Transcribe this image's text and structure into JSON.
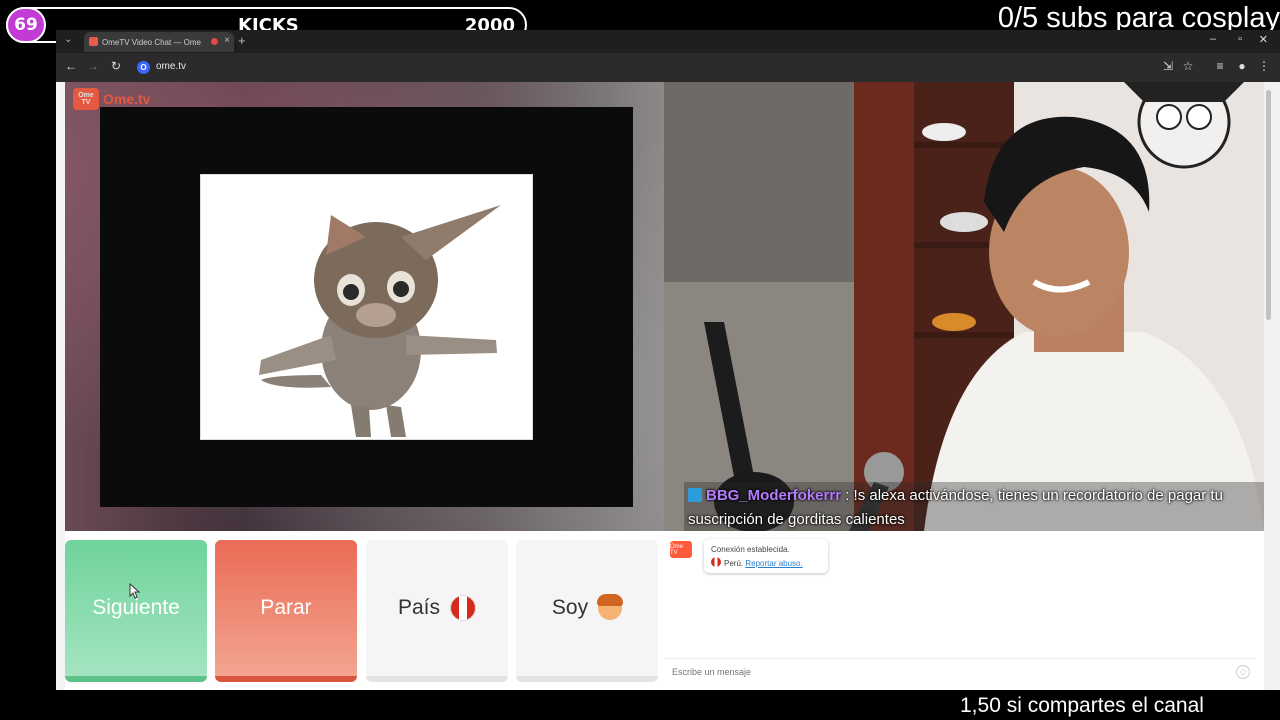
{
  "overlay": {
    "level_badge": "69",
    "kicks_label": "KICKS",
    "kicks_value": "2000",
    "subs_goal": "0/5 subs para cosplay",
    "share_text": "1,50 si compartes el canal"
  },
  "browser": {
    "tab_title": "OmeTV Video Chat — Ome",
    "url": "ome.tv",
    "new_tab": "+",
    "tab_close": "×"
  },
  "app": {
    "logo_text": "Ome.tv",
    "logo_badge": "Ome TV"
  },
  "controls": {
    "next_label": "Siguiente",
    "stop_label": "Parar",
    "country_label": "País",
    "gender_label": "Soy"
  },
  "stream_chat": {
    "username": "BBG_Moderfokerrr",
    "separator": ":",
    "message": "!s alexa activándose, tienes un recordatorio de pagar tu suscripción de gorditas calientes"
  },
  "chat": {
    "system_logo": "Ome TV",
    "connected_text": "Conexión establecida.",
    "country_text": "Perú.",
    "report_link": "Reportar abuso.",
    "input_placeholder": "Escribe un mensaje"
  },
  "colors": {
    "next": "#6fd39b",
    "stop": "#ea6b56",
    "brand": "#ff5a3a",
    "chat_user": "#b47bff"
  }
}
